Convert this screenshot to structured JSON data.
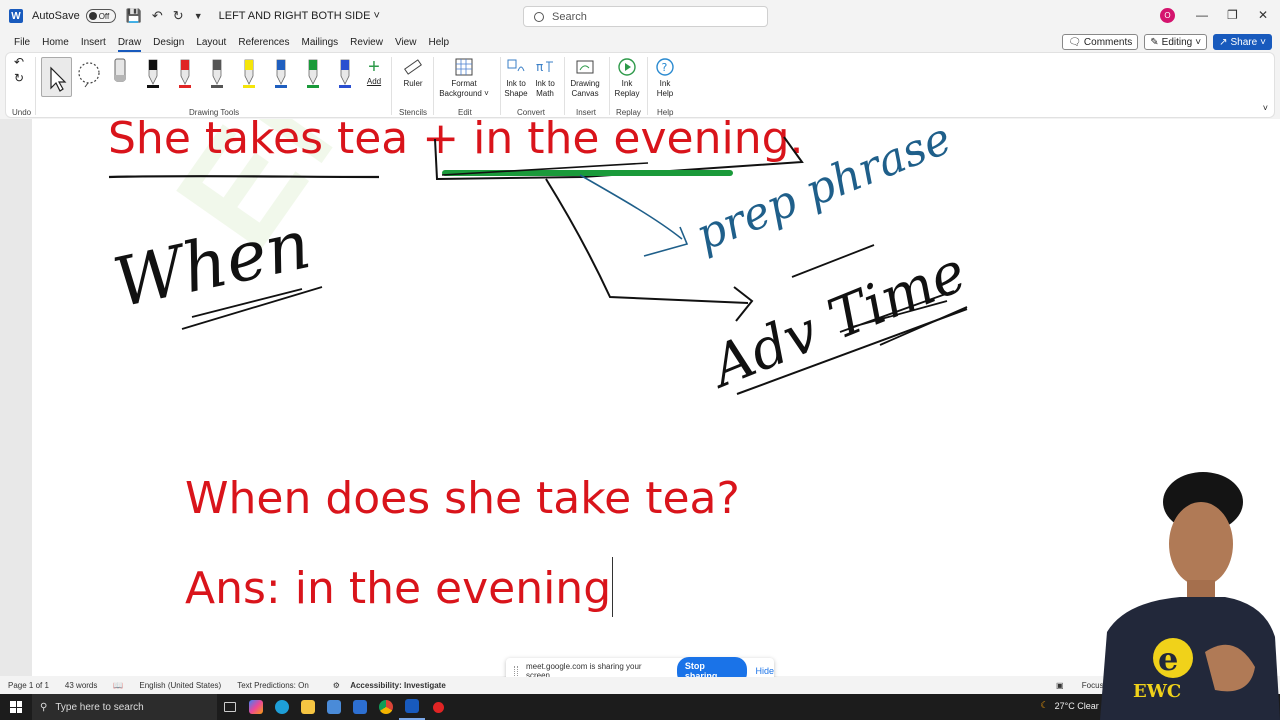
{
  "titlebar": {
    "autosave_label": "AutoSave",
    "autosave_state": "Off",
    "document_title": "LEFT AND RIGHT BOTH SIDE",
    "search_placeholder": "Search",
    "avatar_initial": "O"
  },
  "menu": {
    "tabs": [
      "File",
      "Home",
      "Insert",
      "Draw",
      "Design",
      "Layout",
      "References",
      "Mailings",
      "Review",
      "View",
      "Help"
    ],
    "active_tab": "Draw",
    "comments_label": "Comments",
    "editing_label": "Editing",
    "share_label": "Share"
  },
  "ribbon": {
    "groups": {
      "undo": "Undo",
      "drawing_tools": "Drawing Tools",
      "stencils": "Stencils",
      "edit": "Edit",
      "convert": "Convert",
      "insert": "Insert",
      "replay": "Replay",
      "help": "Help"
    },
    "tools": {
      "add": "Add",
      "ruler": "Ruler",
      "format_background_1": "Format",
      "format_background_2": "Background",
      "ink_to_shape_1": "Ink to",
      "ink_to_shape_2": "Shape",
      "ink_to_math_1": "Ink to",
      "ink_to_math_2": "Math",
      "drawing_canvas_1": "Drawing",
      "drawing_canvas_2": "Canvas",
      "ink_replay_1": "Ink",
      "ink_replay_2": "Replay",
      "ink_help_1": "Ink",
      "ink_help_2": "Help"
    },
    "pen_colors": [
      "#111111",
      "#e02424",
      "#555555",
      "#f5e50a",
      "#1f5fbf",
      "#1a9a3a",
      "#2a4fd0"
    ]
  },
  "document": {
    "sentence_1": "She takes tea + in the evening.",
    "sentence_2": "When does she take tea?",
    "sentence_3": "Ans: in the evening",
    "ink_when": "When",
    "ink_prep_phrase": "prep phrase",
    "ink_adv_time": "Adv Time",
    "text_color": "#d9141b"
  },
  "sharebar": {
    "message": "meet.google.com is sharing your screen.",
    "stop_label": "Stop sharing",
    "hide_label": "Hide"
  },
  "status": {
    "page": "Page 1 of 1",
    "words": "43 words",
    "language": "English (United States)",
    "predictions": "Text Predictions: On",
    "accessibility": "Accessibility: Investigate",
    "focus": "Focus"
  },
  "taskbar": {
    "search_placeholder": "Type here to search",
    "weather": "27°C  Clear"
  }
}
